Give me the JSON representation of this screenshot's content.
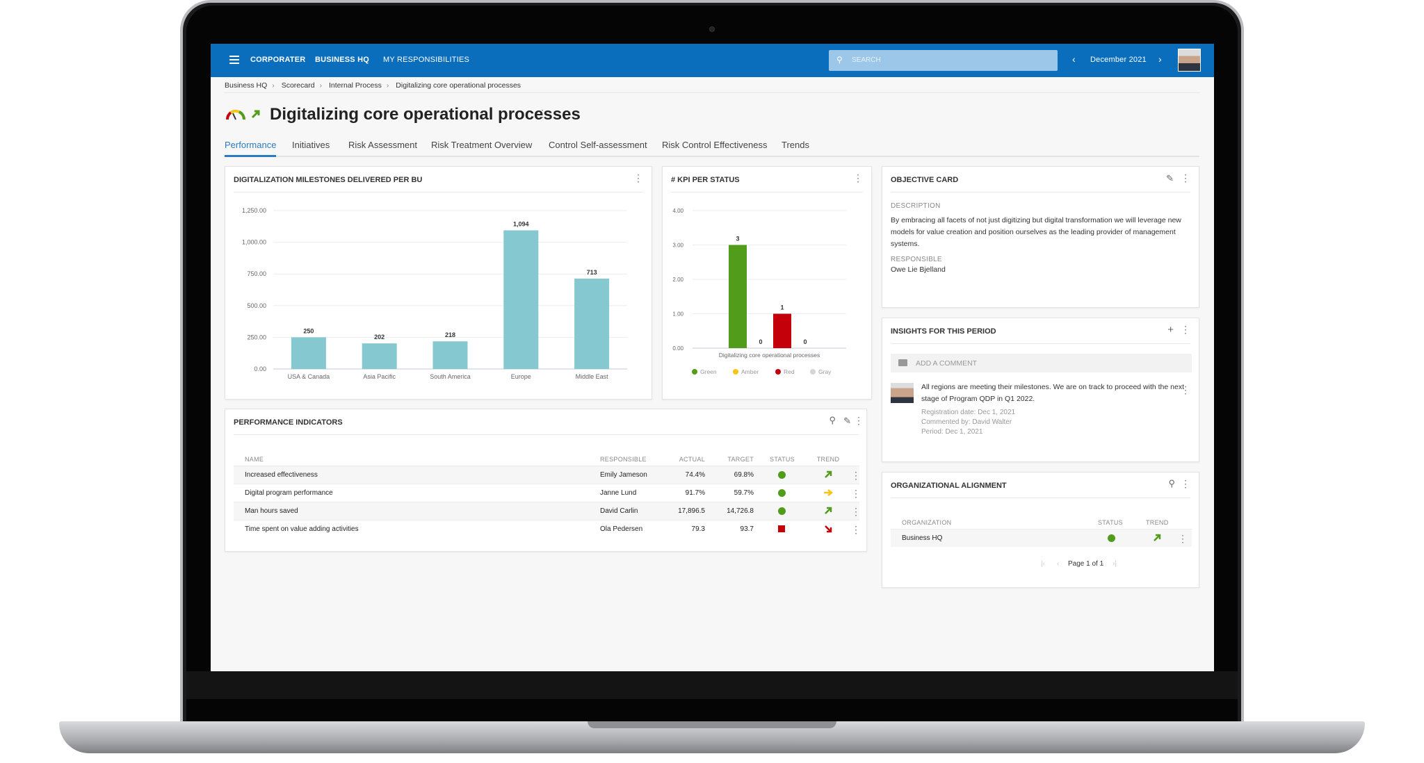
{
  "header": {
    "logo": "CORPORATER",
    "nav": [
      "BUSINESS HQ",
      "MY RESPONSIBILITIES"
    ],
    "search_placeholder": "SEARCH",
    "period": "December 2021",
    "brand_color": "#0a6ebd"
  },
  "breadcrumb": [
    "Business HQ",
    "Scorecard",
    "Internal Process",
    "Digitalizing core operational processes"
  ],
  "page": {
    "title": "Digitalizing core operational processes",
    "trend": "up"
  },
  "tabs": [
    {
      "label": "Performance",
      "active": true
    },
    {
      "label": "Initiatives"
    },
    {
      "label": "Risk Assessment"
    },
    {
      "label": "Risk Treatment Overview"
    },
    {
      "label": "Control Self-assessment"
    },
    {
      "label": "Risk Control Effectiveness"
    },
    {
      "label": "Trends"
    }
  ],
  "chart_data": [
    {
      "type": "bar",
      "title": "DIGITALIZATION MILESTONES DELIVERED PER BU",
      "categories": [
        "USA & Canada",
        "Asia Pacific",
        "South America",
        "Europe",
        "Middle East"
      ],
      "values": [
        250,
        202,
        218,
        1094,
        713
      ],
      "data_labels": [
        "250",
        "202",
        "218",
        "1,094",
        "713"
      ],
      "ylim": [
        0,
        1250
      ],
      "yticks": [
        "0.00",
        "250.00",
        "500.00",
        "750.00",
        "1,000.00",
        "1,250.00"
      ],
      "color": "#86c8cf",
      "grid": true
    },
    {
      "type": "bar",
      "title": "# KPI PER STATUS",
      "categories": [
        "Digitalizing core operational processes"
      ],
      "series": [
        {
          "name": "Green",
          "values": [
            3
          ],
          "color": "#529c1c"
        },
        {
          "name": "Amber",
          "values": [
            0
          ],
          "color": "#f5c518"
        },
        {
          "name": "Red",
          "values": [
            1
          ],
          "color": "#c4000b"
        },
        {
          "name": "Gray",
          "values": [
            0
          ],
          "color": "#d5d5d5"
        }
      ],
      "ylim": [
        0,
        4
      ],
      "yticks": [
        "0.00",
        "1.00",
        "2.00",
        "3.00",
        "4.00"
      ],
      "grid": true,
      "legend": "bottom"
    }
  ],
  "performance": {
    "title": "PERFORMANCE INDICATORS",
    "columns": [
      "NAME",
      "RESPONSIBLE",
      "ACTUAL",
      "TARGET",
      "STATUS",
      "TREND"
    ],
    "rows": [
      {
        "name": "Increased effectiveness",
        "responsible": "Emily Jameson",
        "actual": "74.4%",
        "target": "69.8%",
        "status": "green",
        "trend": "up"
      },
      {
        "name": "Digital program performance",
        "responsible": "Janne Lund",
        "actual": "91.7%",
        "target": "59.7%",
        "status": "green",
        "trend": "flat"
      },
      {
        "name": "Man hours saved",
        "responsible": "David Carlin",
        "actual": "17,896.5",
        "target": "14,726.8",
        "status": "green",
        "trend": "up"
      },
      {
        "name": "Time spent on value adding activities",
        "responsible": "Ola Pedersen",
        "actual": "79.3",
        "target": "93.7",
        "status": "red",
        "trend": "down"
      }
    ]
  },
  "objective": {
    "title": "OBJECTIVE CARD",
    "description_label": "DESCRIPTION",
    "description": "By embracing all facets of not just digitizing but digital transformation we will leverage new models for value creation and position ourselves as the leading provider of management systems.",
    "responsible_label": "RESPONSIBLE",
    "responsible": "Owe Lie Bjelland"
  },
  "insights": {
    "title": "INSIGHTS FOR THIS PERIOD",
    "add_comment": "ADD A COMMENT",
    "comment": {
      "text": "All regions are meeting their milestones. We are on track to proceed with the next stage of Program QDP in Q1 2022.",
      "registration": "Registration date: Dec 1, 2021",
      "by": "Commented by: David Walter",
      "period": "Period: Dec 1, 2021"
    }
  },
  "alignment": {
    "title": "ORGANIZATIONAL ALIGNMENT",
    "columns": [
      "ORGANIZATION",
      "STATUS",
      "TREND"
    ],
    "rows": [
      {
        "organization": "Business HQ",
        "status": "green",
        "trend": "up"
      }
    ],
    "pagination": "Page 1 of 1"
  }
}
